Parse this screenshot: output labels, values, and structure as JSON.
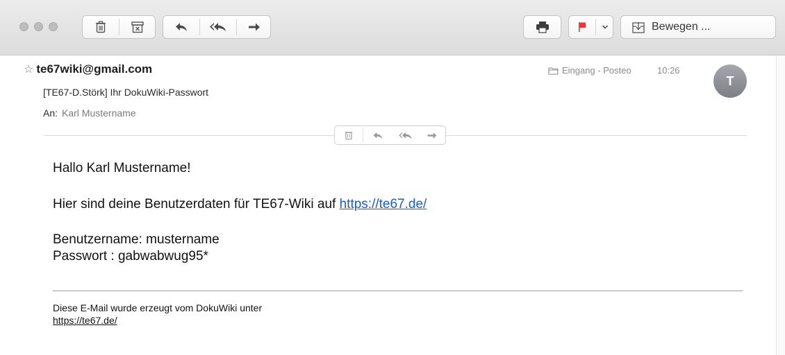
{
  "toolbar": {
    "move_label": "Bewegen ...",
    "flag_color": "#ff2d2d",
    "icons": [
      "trash-icon",
      "archive-icon",
      "reply-icon",
      "reply-all-icon",
      "forward-icon",
      "print-icon",
      "flag-icon",
      "chevron-down-icon",
      "move-icon"
    ]
  },
  "message": {
    "from": "te67wiki@gmail.com",
    "subject": "[TE67-D.Störk] Ihr DokuWiki-Passwort",
    "to_label": "An:",
    "to": "Karl Mustername",
    "mailbox": "Eingang - Posteo",
    "time": "10:26",
    "avatar_initial": "T"
  },
  "body": {
    "greeting": "Hallo Karl Mustername!",
    "intro": "Hier sind deine Benutzerdaten für TE67-Wiki auf",
    "intro_link": "https://te67.de/",
    "username_line": "Benutzername: mustername",
    "password_line": "Passwort : gabwabwug95*",
    "footer_text": "Diese E-Mail wurde erzeugt vom DokuWiki unter",
    "footer_link": "https://te67.de/"
  },
  "colors": {
    "link": "#1a5ad7",
    "flag": "#ff2d2d"
  }
}
